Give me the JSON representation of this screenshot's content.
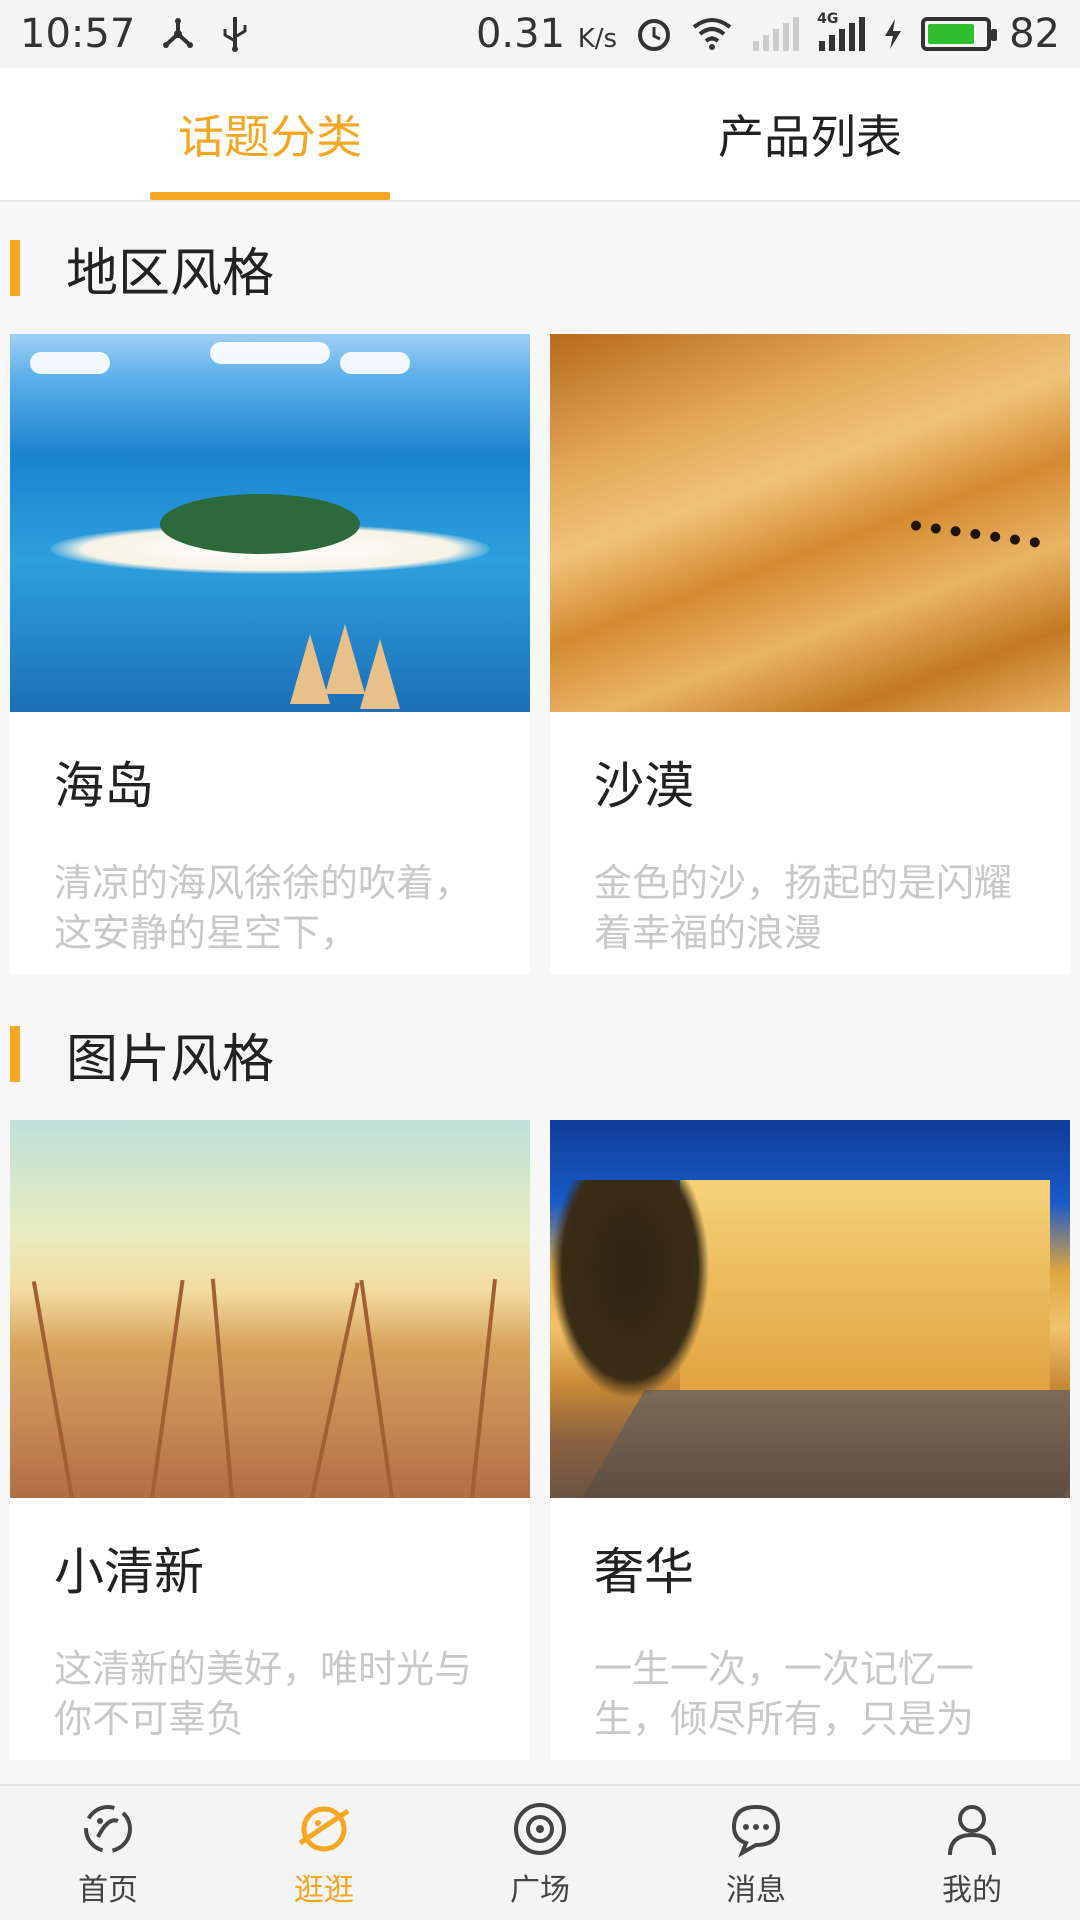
{
  "status_bar": {
    "time": "10:57",
    "speed": "0.31",
    "speed_unit": "K/s",
    "network": "4G",
    "battery": "82",
    "battery_level": 0.82
  },
  "tabs": [
    {
      "label": "话题分类",
      "active": true
    },
    {
      "label": "产品列表",
      "active": false
    }
  ],
  "sections": [
    {
      "title": "地区风格",
      "cards": [
        {
          "title": "海岛",
          "desc": "清凉的海风徐徐的吹着，这安静的星空下，"
        },
        {
          "title": "沙漠",
          "desc": "金色的沙，扬起的是闪耀着幸福的浪漫"
        }
      ]
    },
    {
      "title": "图片风格",
      "cards": [
        {
          "title": "小清新",
          "desc": "这清新的美好，唯时光与你不可辜负"
        },
        {
          "title": "奢华",
          "desc": "一生一次，一次记忆一生，倾尽所有，只是为"
        }
      ]
    }
  ],
  "bottom_nav": [
    {
      "label": "首页",
      "icon": "home-icon",
      "active": false
    },
    {
      "label": "逛逛",
      "icon": "planet-icon",
      "active": true
    },
    {
      "label": "广场",
      "icon": "target-icon",
      "active": false
    },
    {
      "label": "消息",
      "icon": "chat-icon",
      "active": false
    },
    {
      "label": "我的",
      "icon": "profile-icon",
      "active": false
    }
  ],
  "colors": {
    "accent": "#f5a623",
    "battery_fill": "#2fbf2f"
  }
}
